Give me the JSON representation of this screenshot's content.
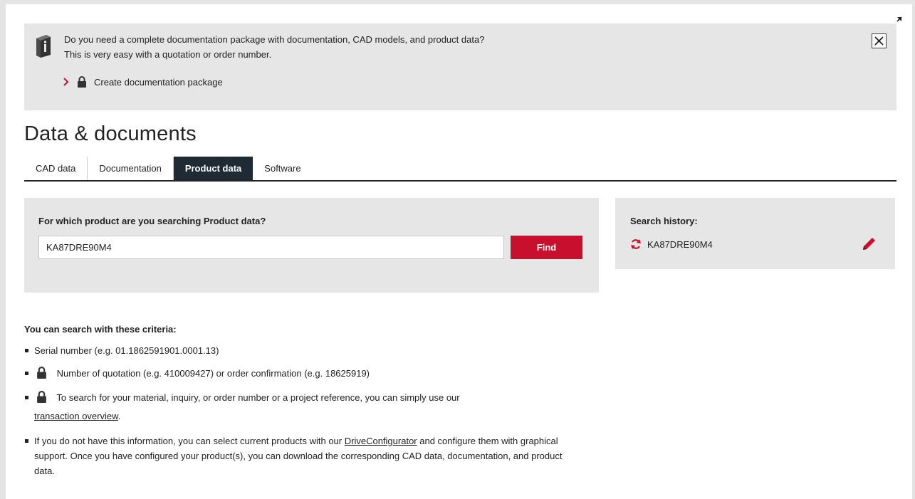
{
  "banner": {
    "line1": "Do you need a complete documentation package with documentation, CAD models, and product data?",
    "line2": "This is very easy with a quotation or order number.",
    "link_label": "Create documentation package"
  },
  "page_title": "Data & documents",
  "tabs": [
    {
      "label": "CAD data",
      "active": false
    },
    {
      "label": "Documentation",
      "active": false
    },
    {
      "label": "Product data",
      "active": true
    },
    {
      "label": "Software",
      "active": false
    }
  ],
  "search": {
    "label": "For which product are you searching Product data?",
    "value": "KA87DRE90M4",
    "button_label": "Find"
  },
  "history": {
    "title": "Search history:",
    "items": [
      "KA87DRE90M4"
    ]
  },
  "criteria": {
    "title": "You can search with these criteria:",
    "item1": "Serial number (e.g. 01.1862591901.0001.13)",
    "item2": "Number of quotation (e.g. 410009427) or order confirmation (e.g. 18625919)",
    "item3_text": "To search for your material, inquiry, or order number or a project reference, you can simply use our",
    "item3_link": "transaction overview",
    "item3_end": ".",
    "item4_pre": "If you do not have this information, you can select current products with our",
    "item4_link": "DriveConfigurator",
    "item4_post": "and configure them with graphical support. Once you have configured your product(s), you can download the corresponding CAD data, documentation, and product data."
  },
  "colors": {
    "accent_red": "#c8102e",
    "active_tab": "#1e2a34",
    "panel_gray": "#e6e6e6"
  },
  "icons": {
    "banner": "info-book-icon",
    "lock": "lock-icon",
    "chevron": "chevron-right-icon",
    "close": "close-icon",
    "expand": "expand-icon",
    "refresh": "refresh-icon",
    "edit": "pencil-icon"
  }
}
